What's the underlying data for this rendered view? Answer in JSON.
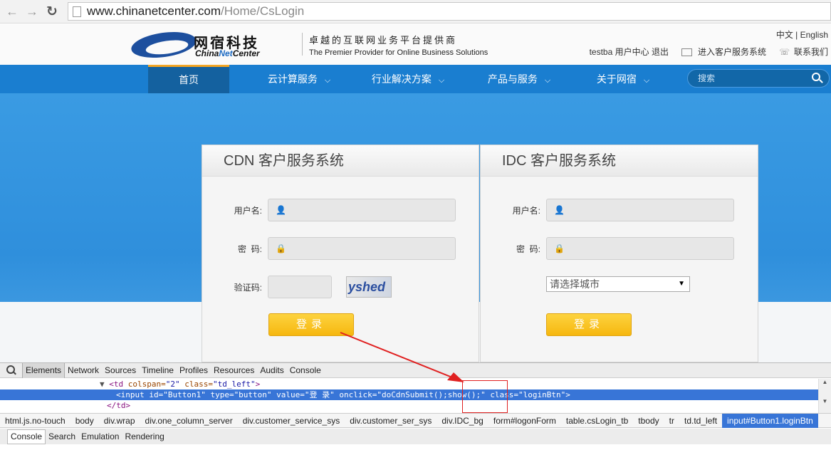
{
  "browser": {
    "url_domain": "www.chinanetcenter.com",
    "url_path": "/Home/CsLogin"
  },
  "header": {
    "logo_cn": "网宿科技",
    "logo_en_a": "China",
    "logo_en_b": "Net",
    "logo_en_c": "Center",
    "slogan_cn": "卓越的互联网业务平台提供商",
    "slogan_en": "The Premier Provider for Online Business Solutions",
    "lang": "中文 | English",
    "user": "testba 用户中心 退出",
    "service_link": "进入客户服务系统",
    "contact_link": "联系我们"
  },
  "nav": {
    "items": [
      {
        "label": "首页"
      },
      {
        "label": "云计算服务"
      },
      {
        "label": "行业解决方案"
      },
      {
        "label": "产品与服务"
      },
      {
        "label": "关于网宿"
      }
    ],
    "search_placeholder": "搜索"
  },
  "cdn_panel": {
    "title": "CDN 客户服务系统",
    "username_label": "用户名:",
    "password_label": "密  码:",
    "captcha_label": "验证码:",
    "captcha_text": "yshed",
    "login_label": "登录"
  },
  "idc_panel": {
    "title": "IDC 客户服务系统",
    "username_label": "用户名:",
    "password_label": "密  码:",
    "city_select": "请选择城市",
    "login_label": "登录"
  },
  "devtools": {
    "tabs": [
      "Elements",
      "Network",
      "Sources",
      "Timeline",
      "Profiles",
      "Resources",
      "Audits",
      "Console"
    ],
    "breadcrumbs": [
      "html.js.no-touch",
      "body",
      "div.wrap",
      "div.one_column_server",
      "div.customer_service_sys",
      "div.customer_ser_sys",
      "div.IDC_bg",
      "form#logonForm",
      "table.csLogin_tb",
      "tbody",
      "tr",
      "td.td_left",
      "input#Button1.loginBtn"
    ],
    "drawer_tabs": [
      "Console",
      "Search",
      "Emulation",
      "Rendering"
    ],
    "code": {
      "line1_tag_open": "<td ",
      "line1_attr1": "colspan=",
      "line1_val1": "\"2\"",
      "line1_attr2": " class=",
      "line1_val2": "\"td_left\"",
      "line1_tag_close": ">",
      "line2": "<input id=\"Button1\" type=\"button\" value=\"登 录\" onclick=\"doCdnSubmit();show();\" class=\"loginBtn\">",
      "line3": "</td>"
    }
  },
  "colors": {
    "nav_bg": "#1a7ed0",
    "nav_active": "#14619f",
    "accent": "#f5a623",
    "button": "#f6b70f",
    "annotation": "#e02020"
  }
}
